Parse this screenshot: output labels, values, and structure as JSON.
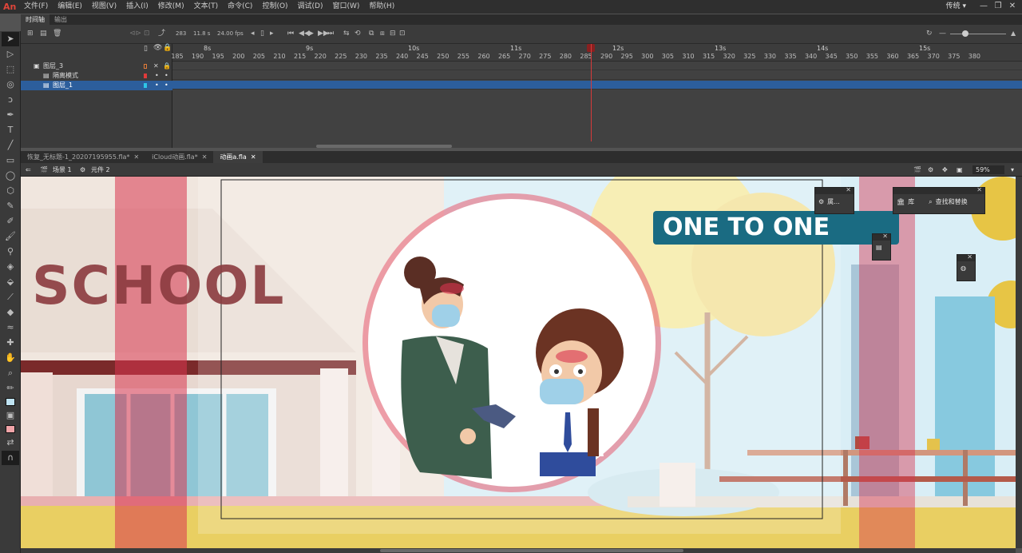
{
  "menubar": {
    "logo": "An",
    "items": [
      "文件(F)",
      "编辑(E)",
      "视图(V)",
      "插入(I)",
      "修改(M)",
      "文本(T)",
      "命令(C)",
      "控制(O)",
      "调试(D)",
      "窗口(W)",
      "帮助(H)"
    ],
    "workspace": "传统 ▾",
    "win_min": "—",
    "win_max": "❐",
    "win_close": "✕"
  },
  "timeline": {
    "tabs": [
      "时间轴",
      "输出"
    ],
    "frame_counter": "283",
    "time": "11.8 s",
    "fps": "24.00 fps",
    "seconds": [
      "8s",
      "9s",
      "10s",
      "11s",
      "12s",
      "13s",
      "14s",
      "15s"
    ],
    "frame_numbers": [
      "185",
      "190",
      "195",
      "200",
      "205",
      "210",
      "215",
      "220",
      "225",
      "230",
      "235",
      "240",
      "245",
      "250",
      "255",
      "260",
      "265",
      "270",
      "275",
      "280",
      "285",
      "290",
      "295",
      "300",
      "305",
      "310",
      "315",
      "320",
      "325",
      "330",
      "335",
      "340",
      "345",
      "350",
      "355",
      "360",
      "365",
      "370",
      "375",
      "380"
    ],
    "layers": [
      {
        "name": "图层_3",
        "type": "folder",
        "color": "#e07b39"
      },
      {
        "name": "隔离模式",
        "type": "layer",
        "color": "#e03a3a"
      },
      {
        "name": "图层_1",
        "type": "layer",
        "color": "#2ec6e8",
        "selected": true
      }
    ]
  },
  "doc_tabs": [
    {
      "label": "恢复_无标题-1_20207195955.fla*",
      "close": "✕",
      "active": false
    },
    {
      "label": "iCloud动画.fla*",
      "close": "✕",
      "active": false
    },
    {
      "label": "动画a.fla",
      "close": "✕",
      "active": true
    }
  ],
  "edit_bar": {
    "back": "⇐",
    "scene_label": "场景 1",
    "symbol_label": "元件 2",
    "zoom": "59%"
  },
  "panels": {
    "library_short": "属...",
    "library": "库",
    "find_replace": "查找和替换"
  },
  "stage": {
    "school_sign": "SCHOOL",
    "banner_text": "ONE TO ONE"
  },
  "colors": {
    "accent_teal": "#1a6b82",
    "pink_overlay": "#d8344f",
    "selection_blue": "#2c5e9c"
  }
}
